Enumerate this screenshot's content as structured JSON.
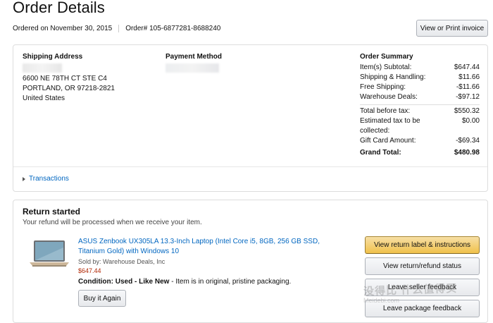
{
  "page": {
    "title": "Order Details",
    "ordered_on": "Ordered on November 30, 2015",
    "order_number": "Order# 105-6877281-8688240",
    "print_button": "View or Print invoice"
  },
  "shipping": {
    "title": "Shipping Address",
    "line1": "6600 NE 78TH CT STE C4",
    "line2": "PORTLAND, OR 97218-2821",
    "line3": "United States"
  },
  "payment": {
    "title": "Payment Method"
  },
  "summary": {
    "title": "Order Summary",
    "rows": [
      {
        "label": "Item(s) Subtotal:",
        "value": "$647.44"
      },
      {
        "label": "Shipping & Handling:",
        "value": "$11.66"
      },
      {
        "label": "Free Shipping:",
        "value": "-$11.66"
      },
      {
        "label": "Warehouse Deals:",
        "value": "-$97.12"
      }
    ],
    "total_before_tax": {
      "label": "Total before tax:",
      "value": "$550.32"
    },
    "estimated_tax": {
      "label": "Estimated tax to be collected:",
      "value": "$0.00"
    },
    "gift_card": {
      "label": "Gift Card Amount:",
      "value": "-$69.34"
    },
    "grand_total": {
      "label": "Grand Total:",
      "value": "$480.98"
    }
  },
  "transactions": {
    "label": "Transactions"
  },
  "return_section": {
    "title": "Return started",
    "subtitle": "Your refund will be processed when we receive your item.",
    "item": {
      "name": "ASUS Zenbook UX305LA 13.3-Inch Laptop (Intel Core i5, 8GB, 256 GB SSD, Titanium Gold) with Windows 10",
      "sold_by": "Sold by: Warehouse Deals, Inc",
      "price": "$647.44",
      "condition_label": "Condition: Used - Like New",
      "condition_note": " - Item is in original, pristine packaging."
    },
    "buy_again": "Buy it Again",
    "actions": {
      "return_label": "View return label & instructions",
      "refund_status": "View return/refund status",
      "seller_feedback": "Leave seller feedback",
      "package_feedback": "Leave package feedback"
    }
  },
  "watermark": {
    "text": "没得比 什么值得买",
    "url": "Meidebi.com"
  },
  "colors": {
    "link": "#0066c0",
    "price": "#b12704",
    "primary_button": "#f0c14b"
  }
}
